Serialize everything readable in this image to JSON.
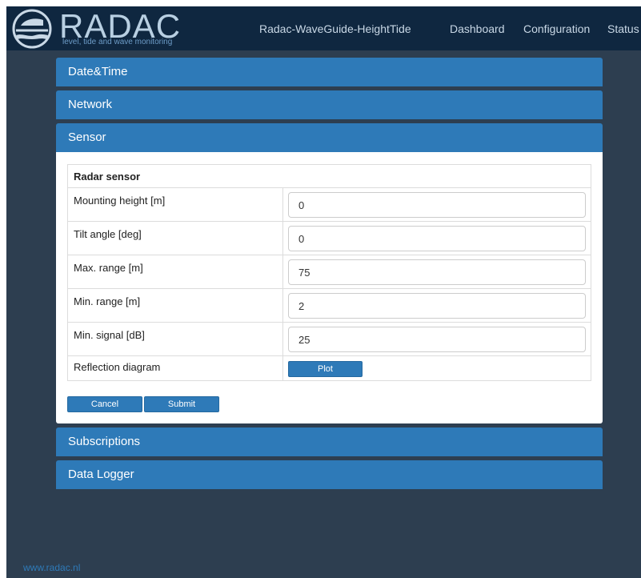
{
  "navbar": {
    "brand": "RADAC",
    "tagline": "level, tide and wave monitoring",
    "device_title": "Radac-WaveGuide-HeightTide",
    "links": [
      "Dashboard",
      "Configuration",
      "Status"
    ]
  },
  "panels": {
    "datetime": "Date&Time",
    "network": "Network",
    "sensor": "Sensor",
    "subscriptions": "Subscriptions",
    "datalogger": "Data Logger"
  },
  "sensor": {
    "section_title": "Radar sensor",
    "rows": [
      {
        "label": "Mounting height [m]",
        "value": "0"
      },
      {
        "label": "Tilt angle [deg]",
        "value": "0"
      },
      {
        "label": "Max. range [m]",
        "value": "75"
      },
      {
        "label": "Min. range [m]",
        "value": "2"
      },
      {
        "label": "Min. signal [dB]",
        "value": "25"
      }
    ],
    "reflection_label": "Reflection diagram",
    "plot_button": "Plot",
    "cancel_button": "Cancel",
    "submit_button": "Submit"
  },
  "footer": {
    "link": "www.radac.nl"
  },
  "colors": {
    "navbar_bg": "#0f2740",
    "page_bg": "#2d3e50",
    "accent": "#2e7ab8",
    "panel_body_bg": "#ffffff"
  }
}
